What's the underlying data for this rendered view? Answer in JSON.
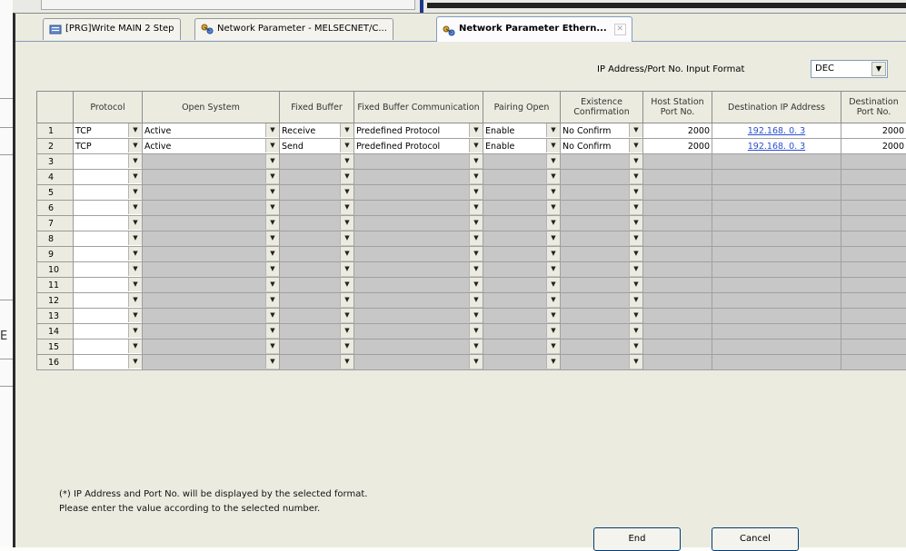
{
  "tabs": [
    {
      "label": "[PRG]Write MAIN 2 Step",
      "active": false
    },
    {
      "label": "Network Parameter - MELSECNET/C...",
      "active": false
    },
    {
      "label": "Network Parameter  Ethern...",
      "active": true
    }
  ],
  "input_format": {
    "label": "IP Address/Port No. Input Format",
    "value": "DEC"
  },
  "columns": [
    "",
    "Protocol",
    "Open System",
    "Fixed Buffer",
    "Fixed Buffer Communication",
    "Pairing Open",
    "Existence Confirmation",
    "Host Station Port No.",
    "Destination IP Address",
    "Destination Port No."
  ],
  "rows": [
    {
      "num": "1",
      "protocol": "TCP",
      "open_system": "Active",
      "fixed_buffer": "Receive",
      "comm": "Predefined Protocol",
      "pairing": "Enable",
      "existence": "No Confirm",
      "host_port": "2000",
      "dest_ip": "192.168.  0.  3",
      "dest_port": "2000"
    },
    {
      "num": "2",
      "protocol": "TCP",
      "open_system": "Active",
      "fixed_buffer": "Send",
      "comm": "Predefined Protocol",
      "pairing": "Enable",
      "existence": "No Confirm",
      "host_port": "2000",
      "dest_ip": "192.168.  0.  3",
      "dest_port": "2000"
    },
    {
      "num": "3"
    },
    {
      "num": "4"
    },
    {
      "num": "5"
    },
    {
      "num": "6"
    },
    {
      "num": "7"
    },
    {
      "num": "8"
    },
    {
      "num": "9"
    },
    {
      "num": "10"
    },
    {
      "num": "11"
    },
    {
      "num": "12"
    },
    {
      "num": "13"
    },
    {
      "num": "14"
    },
    {
      "num": "15"
    },
    {
      "num": "16"
    }
  ],
  "note": [
    "(*) IP Address and Port No. will be displayed by the selected format.",
    "Please enter the value according to the selected number."
  ],
  "buttons": {
    "end": "End",
    "cancel": "Cancel"
  },
  "icons": {
    "tab1": "program-icon",
    "tab2": "network-icon",
    "tab3": "network-icon",
    "dropdown": "dropdown-arrow-icon"
  }
}
